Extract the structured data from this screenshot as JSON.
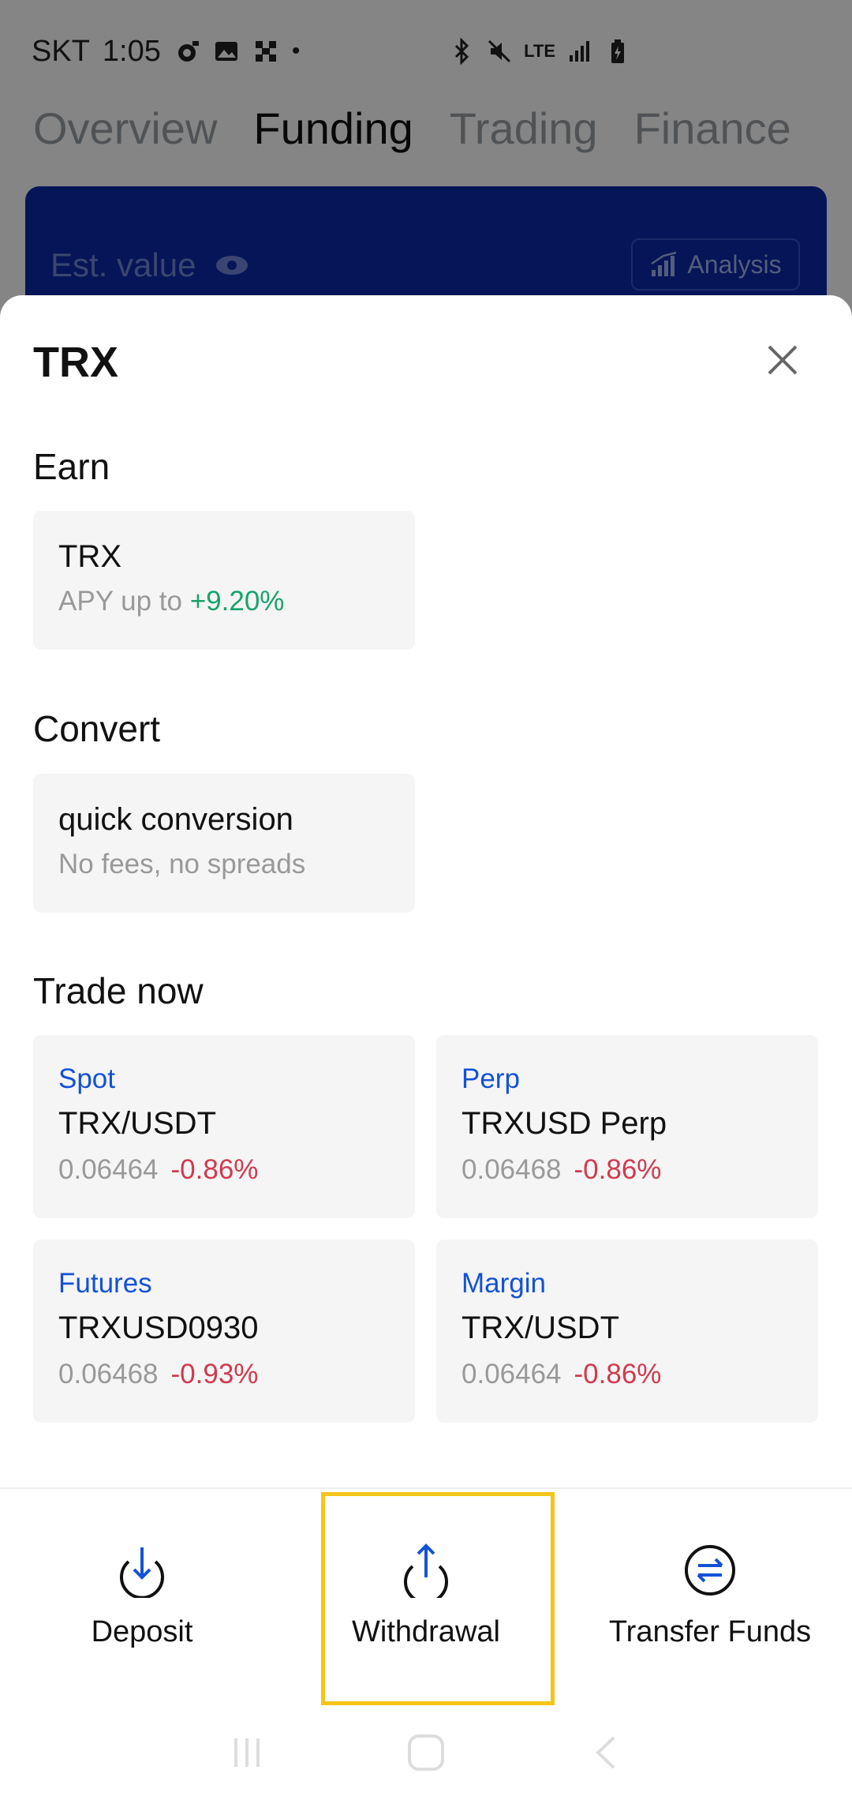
{
  "status_bar": {
    "carrier": "SKT",
    "time": "1:05",
    "network": "LTE"
  },
  "top_tabs": [
    {
      "label": "Overview",
      "active": false
    },
    {
      "label": "Funding",
      "active": true
    },
    {
      "label": "Trading",
      "active": false
    },
    {
      "label": "Finance",
      "active": false
    }
  ],
  "funding_card": {
    "est_label": "Est. value",
    "analysis_label": "Analysis"
  },
  "sheet": {
    "title": "TRX",
    "earn": {
      "section_title": "Earn",
      "card_title": "TRX",
      "apy_prefix": "APY up to",
      "apy_value": "+9.20%"
    },
    "convert": {
      "section_title": "Convert",
      "card_title": "quick conversion",
      "card_sub": "No fees, no spreads"
    },
    "trade": {
      "section_title": "Trade now",
      "items": [
        {
          "type": "Spot",
          "pair": "TRX/USDT",
          "price": "0.06464",
          "change": "-0.86%"
        },
        {
          "type": "Perp",
          "pair": "TRXUSD Perp",
          "price": "0.06468",
          "change": "-0.86%"
        },
        {
          "type": "Futures",
          "pair": "TRXUSD0930",
          "price": "0.06468",
          "change": "-0.93%"
        },
        {
          "type": "Margin",
          "pair": "TRX/USDT",
          "price": "0.06464",
          "change": "-0.86%"
        }
      ]
    }
  },
  "actions": {
    "deposit": "Deposit",
    "withdrawal": "Withdrawal",
    "transfer": "Transfer Funds"
  },
  "colors": {
    "accent_blue": "#1352d6",
    "positive": "#18a36b",
    "negative": "#cf3a4e",
    "highlight": "#f5c518",
    "card_bg": "#0a2aa8"
  }
}
